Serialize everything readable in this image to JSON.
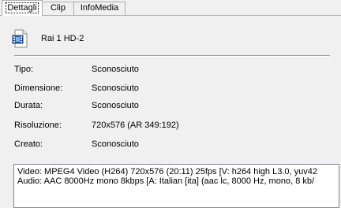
{
  "tabs": [
    {
      "label": "Dettagli",
      "active": true
    },
    {
      "label": "Clip",
      "active": false
    },
    {
      "label": "InfoMedia",
      "active": false
    }
  ],
  "file": {
    "name": "Rai 1 HD-2",
    "icon": "video-file-icon"
  },
  "properties": [
    {
      "label": "Tipo:",
      "value": "Sconosciuto"
    },
    {
      "label": "Dimensione:",
      "value": "Sconosciuto"
    },
    {
      "label": "Durata:",
      "value": "Sconosciuto"
    },
    {
      "label": "Risoluzione:",
      "value": "720x576 (AR 349:192)"
    },
    {
      "label": "Creato:",
      "value": "Sconosciuto"
    }
  ],
  "mediainfo": {
    "video": "Video: MPEG4 Video (H264) 720x576 (20:11) 25fps [V: h264 high L3.0, yuv42",
    "audio": "Audio: AAC 8000Hz mono 8kbps [A: Italian [ita] (aac lc, 8000 Hz, mono, 8 kb/"
  },
  "colors": {
    "window_bg": "#f0f0f0",
    "text_box_bg": "#ffffff",
    "border": "#adadad"
  }
}
